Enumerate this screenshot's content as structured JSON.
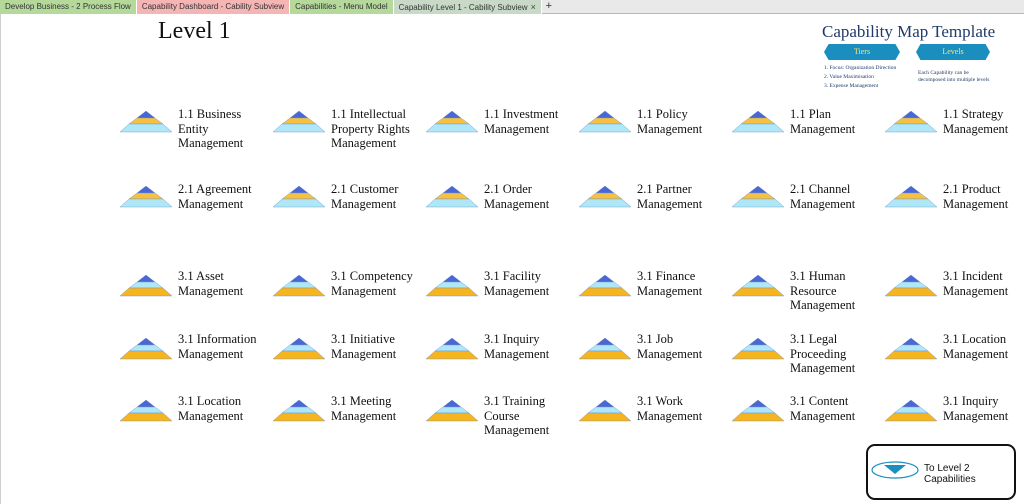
{
  "tabs": [
    {
      "label": "Develop Business - 2 Process Flow",
      "color": "#b5d99b",
      "active": false
    },
    {
      "label": "Capability Dashboard - Cability Subview",
      "color": "#f5b5b5",
      "active": false
    },
    {
      "label": "Capabilities - Menu Model",
      "color": "#b5d99b",
      "active": false
    },
    {
      "label": "Capability Level 1 - Cability Subview",
      "color": "#c8d9c8",
      "active": true,
      "close": "×"
    }
  ],
  "tab_add": "+",
  "page": {
    "title": "Level 1"
  },
  "legend": {
    "title": "Capability Map Template",
    "tiers_label": "Tiers",
    "levels_label": "Levels",
    "tiers": [
      "1. Focus: Organization Direction",
      "2. Value Maximisation",
      "3. Expense Management"
    ],
    "levels_note": "Each Capability can be decomposed into multiple levels"
  },
  "capabilities": [
    {
      "label": "1.1 Business Entity Management",
      "tier": 1
    },
    {
      "label": "1.1 Intellectual Property Rights Management",
      "tier": 1
    },
    {
      "label": "1.1 Investment Management",
      "tier": 1
    },
    {
      "label": "1.1 Policy Management",
      "tier": 1
    },
    {
      "label": "1.1 Plan Management",
      "tier": 1
    },
    {
      "label": "1.1 Strategy Management",
      "tier": 1
    },
    {
      "label": "2.1 Agreement Management",
      "tier": 2
    },
    {
      "label": "2.1 Customer Management",
      "tier": 2
    },
    {
      "label": "2.1 Order Management",
      "tier": 2
    },
    {
      "label": "2.1 Partner Management",
      "tier": 2
    },
    {
      "label": "2.1 Channel Management",
      "tier": 2
    },
    {
      "label": "2.1 Product Management",
      "tier": 2
    },
    {
      "label": "3.1 Asset Management",
      "tier": 3
    },
    {
      "label": "3.1 Competency Management",
      "tier": 3
    },
    {
      "label": "3.1 Facility Management",
      "tier": 3
    },
    {
      "label": "3.1 Finance Management",
      "tier": 3
    },
    {
      "label": "3.1 Human Resource Management",
      "tier": 3
    },
    {
      "label": "3.1 Incident Management",
      "tier": 3
    },
    {
      "label": "3.1 Information Management",
      "tier": 3
    },
    {
      "label": "3.1 Initiative Management",
      "tier": 3
    },
    {
      "label": "3.1 Inquiry Management",
      "tier": 3
    },
    {
      "label": "3.1 Job Management",
      "tier": 3
    },
    {
      "label": "3.1 Legal Proceeding Management",
      "tier": 3
    },
    {
      "label": "3.1 Location Management",
      "tier": 3
    },
    {
      "label": "3.1 Location Management",
      "tier": 3
    },
    {
      "label": "3.1 Meeting Management",
      "tier": 3
    },
    {
      "label": "3.1 Training Course Management",
      "tier": 3
    },
    {
      "label": "3.1 Work Management",
      "tier": 3
    },
    {
      "label": "3.1 Content Management",
      "tier": 3
    },
    {
      "label": "3.1 Inquiry Management",
      "tier": 3
    }
  ],
  "nav": {
    "label": "To Level 2 Capabilities",
    "icon": "triangle-down-icon"
  },
  "colors": {
    "pyramid_top": "#4a67d6",
    "pyramid_mid": "#f6c141",
    "pyramid_base": "#aee7f7",
    "pyramid_base_alt": "#f6b41f",
    "legend_text": "#1f3a6b",
    "pill": "#1a8fbf"
  }
}
